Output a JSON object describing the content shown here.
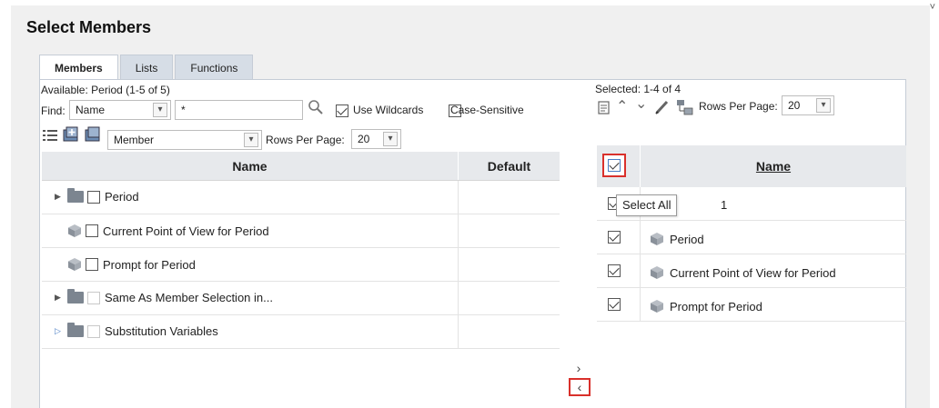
{
  "dialog": {
    "title": "Select Members"
  },
  "tabs": [
    {
      "label": "Members",
      "active": true
    },
    {
      "label": "Lists",
      "active": false
    },
    {
      "label": "Functions",
      "active": false
    }
  ],
  "available": {
    "label": "Available:  Period (1-5 of 5)",
    "find_label": "Find:",
    "find_field": "Name",
    "find_value": "*",
    "use_wildcards_label": "Use Wildcards",
    "use_wildcards_checked": true,
    "case_sensitive_label": "Case-Sensitive",
    "case_sensitive_checked": false,
    "view_select": "Member",
    "rows_per_page_label": "Rows Per Page:",
    "rows_per_page_value": "20",
    "columns": {
      "name": "Name",
      "default": "Default"
    },
    "rows": [
      {
        "label": "Period",
        "kind": "folder",
        "expander": "▶",
        "checkbox": true
      },
      {
        "label": "Current Point of View for Period",
        "kind": "member",
        "expander": "",
        "checkbox": true
      },
      {
        "label": "Prompt for Period",
        "kind": "member",
        "expander": "",
        "checkbox": true
      },
      {
        "label": "Same As Member Selection in...",
        "kind": "folder",
        "expander": "▶",
        "checkbox": false
      },
      {
        "label": "Substitution Variables",
        "kind": "folder",
        "expander": "▷",
        "checkbox": false
      }
    ]
  },
  "selected": {
    "label": "Selected:   1-4 of 4",
    "rows_per_page_label": "Rows Per Page:",
    "rows_per_page_value": "20",
    "columns": {
      "name": "Name"
    },
    "tooltip": "Select All",
    "rows": [
      {
        "label": "1",
        "icon": false,
        "checked": true
      },
      {
        "label": "Period",
        "icon": true,
        "checked": true
      },
      {
        "label": "Current Point of View for Period",
        "icon": true,
        "checked": true
      },
      {
        "label": "Prompt for Period",
        "icon": true,
        "checked": true
      }
    ]
  },
  "move_right_glyph": "›",
  "move_left_glyph": "‹",
  "colors": {
    "highlight": "#d9302b",
    "header_bg": "#e7e9ec",
    "tab_bg": "#d6dde6"
  }
}
